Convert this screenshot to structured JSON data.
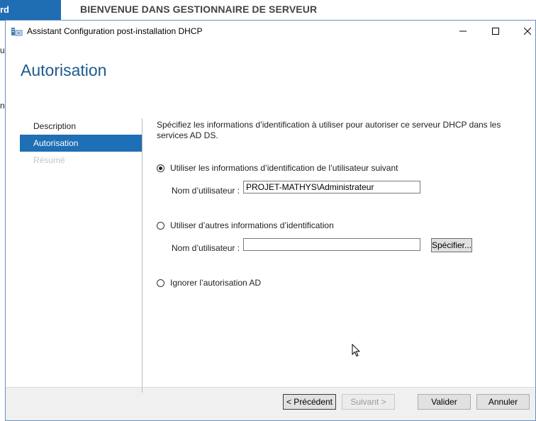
{
  "background": {
    "nav_fragment": "rd",
    "title": "BIENVENUE DANS GESTIONNAIRE DE SERVEUR",
    "side_fragment_1": "ur",
    "side_fragment_2": "ni"
  },
  "dialog": {
    "title": "Assistant Configuration post-installation DHCP",
    "window_controls": {
      "minimize": "—",
      "maximize": "☐",
      "close": "✕"
    },
    "heading": "Autorisation",
    "nav": [
      {
        "label": "Description",
        "state": "normal"
      },
      {
        "label": "Autorisation",
        "state": "active"
      },
      {
        "label": "Résumé",
        "state": "disabled"
      }
    ],
    "intro": "Spécifiez les informations d’identification à utiliser pour autoriser ce serveur DHCP dans les services AD DS.",
    "option1": {
      "label": "Utiliser les informations d’identification de l’utilisateur suivant",
      "checked": true,
      "username_label": "Nom d’utilisateur :",
      "username_value": "PROJET-MATHYS\\Administrateur"
    },
    "option2": {
      "label": "Utiliser d’autres informations d’identification",
      "checked": false,
      "username_label": "Nom d’utilisateur :",
      "username_value": "",
      "specify_button": "Spécifier..."
    },
    "option3": {
      "label": "Ignorer l’autorisation AD",
      "checked": false
    },
    "buttons": {
      "previous": "< Précédent",
      "next": "Suivant >",
      "validate": "Valider",
      "cancel": "Annuler"
    }
  }
}
